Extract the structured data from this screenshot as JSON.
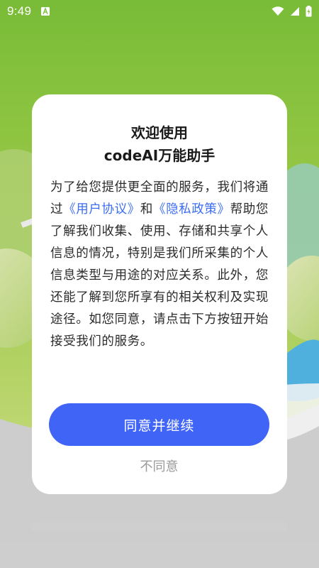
{
  "status_bar": {
    "time": "9:49",
    "left_icon": "a-notification-icon",
    "right_icons": [
      "wifi-icon",
      "signal-icon",
      "battery-charging-icon"
    ]
  },
  "dialog": {
    "title_line1": "欢迎使用",
    "title_line2": "codeAI万能助手",
    "body_part1": "为了给您提供更全面的服务，我们将通过",
    "link_user_agreement": "《用户协议》",
    "body_and": "和",
    "link_privacy_policy": "《隐私政策》",
    "body_part2": "帮助您了解我们收集、使用、存储和共享个人信息的情况，特别是我们所采集的个人信息类型与用途的对应关系。此外，您还能了解到您所享有的相关权利及实现途径。如您同意，请点击下方按钮开始接受我们的服务。",
    "agree_label": "同意并继续",
    "disagree_label": "不同意"
  },
  "colors": {
    "accent": "#4064f6",
    "link": "#3d6ef0",
    "background_green": "#7cc23a"
  }
}
